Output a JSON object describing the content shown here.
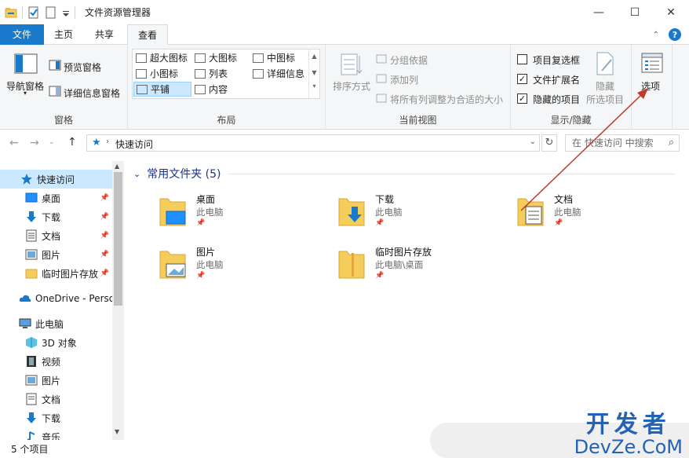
{
  "window": {
    "title": "文件资源管理器",
    "minimize": "—",
    "maximize": "☐",
    "close": "✕"
  },
  "tabs": [
    {
      "label": "文件"
    },
    {
      "label": "主页"
    },
    {
      "label": "共享"
    },
    {
      "label": "查看"
    }
  ],
  "ribbon": {
    "panes": {
      "nav_pane": "导航窗格",
      "preview_pane": "预览窗格",
      "details_pane": "详细信息窗格",
      "group": "窗格"
    },
    "layout": {
      "items": [
        "超大图标",
        "大图标",
        "中图标",
        "小图标",
        "列表",
        "详细信息",
        "平铺",
        "内容"
      ],
      "selected": "平铺",
      "group": "布局"
    },
    "current_view": {
      "sort": "排序方式",
      "group_by": "分组依据",
      "add_column": "添加列",
      "fit_columns": "将所有列调整为合适的大小",
      "group": "当前视图"
    },
    "show_hide": {
      "item_checkboxes": "项目复选框",
      "item_checkboxes_checked": false,
      "file_extensions": "文件扩展名",
      "file_extensions_checked": true,
      "hidden_items": "隐藏的项目",
      "hidden_items_checked": true,
      "hide": "隐藏",
      "hide_selected": "所选项目",
      "group": "显示/隐藏"
    },
    "options": "选项"
  },
  "address": {
    "path": "快速访问",
    "search_placeholder": "在 快速访问 中搜索"
  },
  "nav": {
    "quick_access": "快速访问",
    "quick_items": [
      "桌面",
      "下载",
      "文档",
      "图片",
      "临时图片存放"
    ],
    "onedrive": "OneDrive - Perso",
    "this_pc": "此电脑",
    "pc_items": [
      "3D 对象",
      "视频",
      "图片",
      "文档",
      "下载",
      "音乐"
    ]
  },
  "content": {
    "section": "常用文件夹 (5)",
    "tiles": [
      {
        "name": "桌面",
        "location": "此电脑"
      },
      {
        "name": "下载",
        "location": "此电脑"
      },
      {
        "name": "文档",
        "location": "此电脑"
      },
      {
        "name": "图片",
        "location": "此电脑"
      },
      {
        "name": "临时图片存放",
        "location": "此电脑\\桌面"
      }
    ]
  },
  "status": {
    "count": "5 个项目"
  },
  "watermark": {
    "cn": "开发者",
    "en": "DevZe.CoM"
  },
  "colors": {
    "accent": "#1979ca",
    "selection": "#cce8ff",
    "arrow": "#c0392b",
    "folder": "#f5cd5b"
  }
}
